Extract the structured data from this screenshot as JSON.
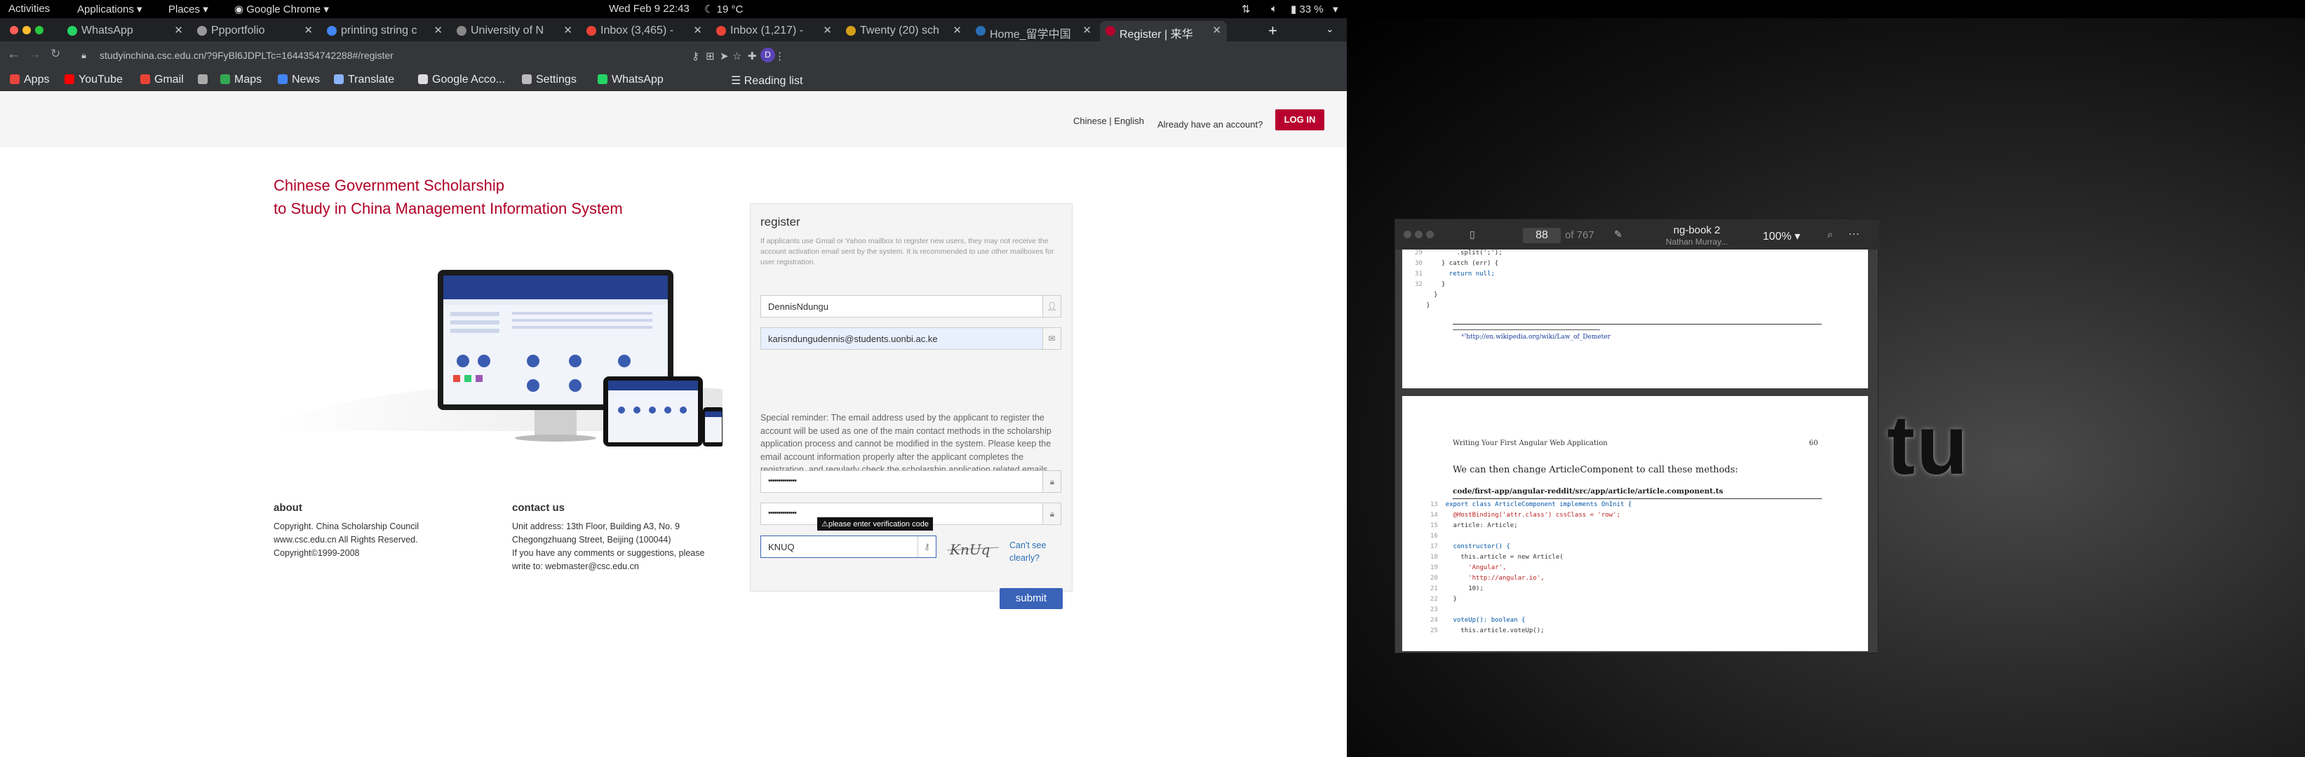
{
  "topbar": {
    "activities": "Activities",
    "applications": "Applications ▾",
    "places": "Places ▾",
    "app": "Google Chrome ▾",
    "clock": "Wed Feb 9  22:43",
    "weather": "19 °C",
    "battery": "33 %"
  },
  "browser": {
    "tabs": [
      {
        "label": "WhatsApp",
        "color": "#25d366"
      },
      {
        "label": "Ppportfolio",
        "color": "#999999"
      },
      {
        "label": "printing string c",
        "color": "#4285f4"
      },
      {
        "label": "University of N",
        "color": "#888888"
      },
      {
        "label": "Inbox (3,465) -",
        "color": "#ea4335"
      },
      {
        "label": "Inbox (1,217) -",
        "color": "#ea4335"
      },
      {
        "label": "Twenty (20) sch",
        "color": "#d4a017"
      },
      {
        "label": "Home_留学中国",
        "color": "#2a6fb6"
      },
      {
        "label": "Register | 来华",
        "color": "#b8002e"
      }
    ],
    "url": "studyinchina.csc.edu.cn/?9FyBl6JDPLTc=1644354742288#/register",
    "bookmarks": [
      {
        "label": "Apps",
        "color": "#e8453c"
      },
      {
        "label": "YouTube",
        "color": "#ff0000"
      },
      {
        "label": "Gmail",
        "color": "#ea4335"
      },
      {
        "label": "",
        "color": "#aaaaaa"
      },
      {
        "label": "Maps",
        "color": "#34a853"
      },
      {
        "label": "News",
        "color": "#4285f4"
      },
      {
        "label": "Translate",
        "color": "#8ab4f8"
      },
      {
        "label": "Google Acco...",
        "color": "#dddddd"
      },
      {
        "label": "Settings",
        "color": "#bbbbbb"
      },
      {
        "label": "WhatsApp",
        "color": "#25d366"
      }
    ],
    "reading_list": "Reading list",
    "profile_initial": "D"
  },
  "header": {
    "language": "Chinese | English",
    "account_prompt": "Already have an account?",
    "login": "LOG IN"
  },
  "hero": {
    "title_line1": "Chinese Government Scholarship",
    "title_line2": "to Study in China Management Information System"
  },
  "footer": {
    "about_title": "about",
    "about_lines": [
      "Copyright. China Scholarship Council",
      "www.csc.edu.cn All Rights Reserved.",
      "Copyright©1999-2008"
    ],
    "contact_title": "contact us",
    "contact_lines": [
      "Unit address: 13th Floor, Building A3, No. 9",
      "Chegongzhuang Street, Beijing (100044)",
      "If you have any comments or suggestions, please",
      "write to: webmaster@csc.edu.cn"
    ]
  },
  "form": {
    "title": "register",
    "note": "If applicants use Gmail or Yahoo mailbox to register new users, they may not receive the account activation email sent by the system. It is recommended to use other mailboxes for user registration.",
    "username": "DennisNdungu",
    "email": "karisndungudennis@students.uonbi.ac.ke",
    "reminder": "Special reminder: The email address used by the applicant to register the account will be used as one of the main contact methods in the scholarship application process and cannot be modified in the system. Please keep the email account information properly after the applicant completes the registration, and regularly check the scholarship application related emails.",
    "password": "••••••••••••••",
    "confirm_password": "••••••••••••••",
    "captcha_value": "KNUQ",
    "captcha_image_text": "KnUq",
    "tooltip": "please enter verification code",
    "cant_see": "Can't see clearly?",
    "submit": "submit"
  },
  "pdf_viewer": {
    "page": "88",
    "of": "of 767",
    "title": "ng-book 2",
    "author": "Nathan Murray...",
    "zoom": "100% ▾",
    "footnote": "⁴⁷http://en.wikipedia.org/wiki/Law_of_Demeter",
    "running_head": "Writing Your First Angular Web Application",
    "page_number": "60",
    "body_text": "We can then change ArticleComponent to call these methods:",
    "file_path": "code/first-app/angular-reddit/src/app/article/article.component.ts",
    "top_code_numbers": [
      "29",
      "30",
      "31",
      "32"
    ],
    "code_lines": [
      {
        "n": "13",
        "t": "export class ArticleComponent implements OnInit {"
      },
      {
        "n": "14",
        "t": "  @HostBinding('attr.class') cssClass = 'row';"
      },
      {
        "n": "15",
        "t": "  article: Article;"
      },
      {
        "n": "16",
        "t": ""
      },
      {
        "n": "17",
        "t": "  constructor() {"
      },
      {
        "n": "18",
        "t": "    this.article = new Article("
      },
      {
        "n": "19",
        "t": "      'Angular',"
      },
      {
        "n": "20",
        "t": "      'http://angular.io',"
      },
      {
        "n": "21",
        "t": "      10);"
      },
      {
        "n": "22",
        "t": "  }"
      },
      {
        "n": "23",
        "t": ""
      },
      {
        "n": "24",
        "t": "  voteUp(): boolean {"
      },
      {
        "n": "25",
        "t": "    this.article.voteUp();"
      }
    ]
  },
  "desktop": {
    "logo_text": "tu"
  }
}
